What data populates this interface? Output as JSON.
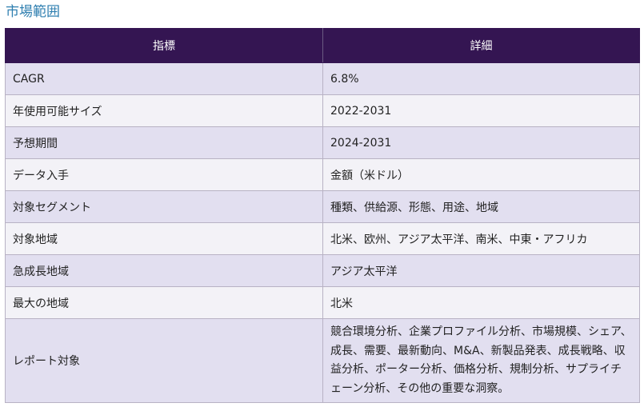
{
  "title": "市場範囲",
  "table": {
    "headers": [
      "指標",
      "詳細"
    ],
    "rows": [
      {
        "metric": "CAGR",
        "detail": "6.8%"
      },
      {
        "metric": "年使用可能サイズ",
        "detail": "2022-2031"
      },
      {
        "metric": "予想期間",
        "detail": "2024-2031"
      },
      {
        "metric": "データ入手",
        "detail": "金額（米ドル）"
      },
      {
        "metric": "対象セグメント",
        "detail": "種類、供給源、形態、用途、地域"
      },
      {
        "metric": "対象地域",
        "detail": "北米、欧州、アジア太平洋、南米、中東・アフリカ"
      },
      {
        "metric": "急成長地域",
        "detail": "アジア太平洋"
      },
      {
        "metric": "最大の地域",
        "detail": "北米"
      },
      {
        "metric": "レポート対象",
        "detail": "競合環境分析、企業プロファイル分析、市場規模、シェア、成長、需要、最新動向、M&A、新製品発表、成長戦略、収益分析、ポーター分析、価格分析、規制分析、サプライチェーン分析、その他の重要な洞察。"
      }
    ]
  },
  "colors": {
    "title": "#2f7fb0",
    "header_bg": "#341552",
    "row_odd": "#e2dff0",
    "row_even": "#f3f2f7"
  }
}
